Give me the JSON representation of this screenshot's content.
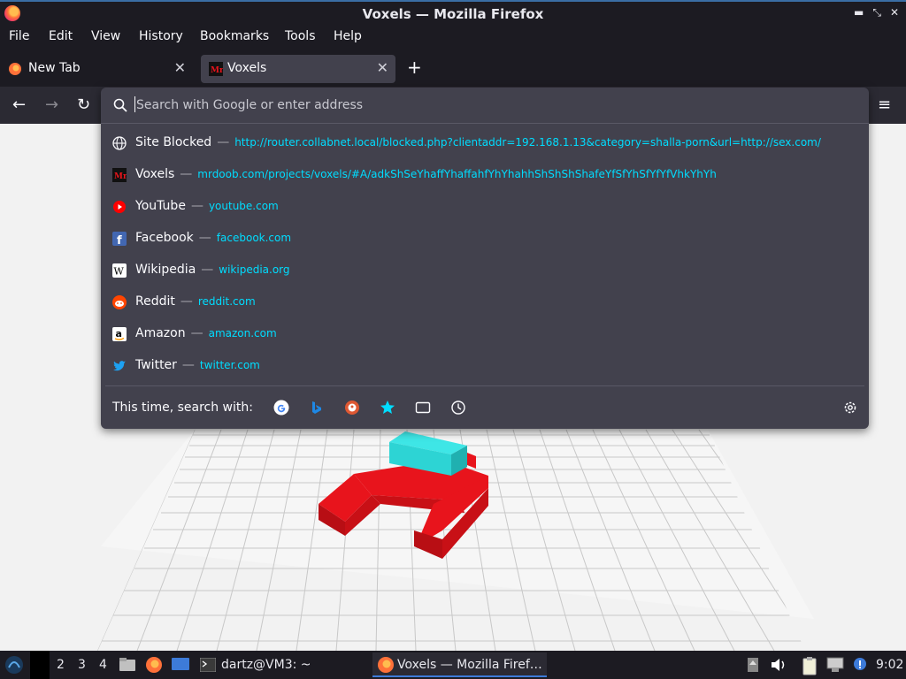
{
  "window": {
    "title": "Voxels — Mozilla Firefox"
  },
  "menu": {
    "file": "File",
    "edit": "Edit",
    "view": "View",
    "history": "History",
    "bookmarks": "Bookmarks",
    "tools": "Tools",
    "help": "Help"
  },
  "tabs": [
    {
      "label": "New Tab"
    },
    {
      "label": "Voxels"
    }
  ],
  "urlbar": {
    "placeholder": "Search with Google or enter address"
  },
  "suggestions": [
    {
      "title": "Site Blocked",
      "url": "http://router.collabnet.local/blocked.php?clientaddr=192.168.1.13&category=shalla-porn&url=http://sex.com/",
      "icon": "globe-icon"
    },
    {
      "title": "Voxels",
      "url": "mrdoob.com/projects/voxels/#A/adkShSeYhaffYhaffahfYhYhahhShShShShafeYfSfYhSfYfYfVhkYhYh",
      "icon": "mrdoob-icon"
    },
    {
      "title": "YouTube",
      "url": "youtube.com",
      "icon": "youtube-icon"
    },
    {
      "title": "Facebook",
      "url": "facebook.com",
      "icon": "facebook-icon"
    },
    {
      "title": "Wikipedia",
      "url": "wikipedia.org",
      "icon": "wikipedia-icon"
    },
    {
      "title": "Reddit",
      "url": "reddit.com",
      "icon": "reddit-icon"
    },
    {
      "title": "Amazon",
      "url": "amazon.com",
      "icon": "amazon-icon"
    },
    {
      "title": "Twitter",
      "url": "twitter.com",
      "icon": "twitter-icon"
    }
  ],
  "separator": "—",
  "search_with": {
    "label": "This time, search with:",
    "engines": [
      "google-icon",
      "bing-icon",
      "duckduckgo-icon",
      "bookmarks-star-icon",
      "tabs-icon",
      "history-clock-icon"
    ]
  },
  "taskbar": {
    "workspaces": [
      "2",
      "3",
      "4"
    ],
    "terminal": "dartz@VM3: ~",
    "firefox": "Voxels — Mozilla Firef…",
    "clock": "9:02"
  },
  "colors": {
    "voxel_red": "#e8141c",
    "voxel_cyan": "#2dd4d4",
    "url_cyan": "#00ddff",
    "popup_bg": "#42414d"
  }
}
